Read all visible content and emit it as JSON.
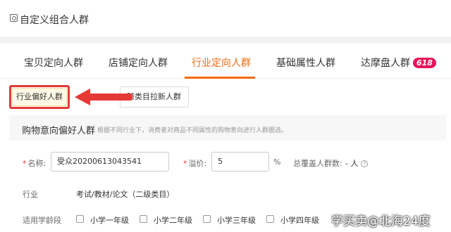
{
  "header": {
    "title": "自定义组合人群",
    "icon": "audience-icon"
  },
  "tabs": [
    {
      "label": "宝贝定向人群",
      "active": false
    },
    {
      "label": "店铺定向人群",
      "active": false
    },
    {
      "label": "行业定向人群",
      "active": true
    },
    {
      "label": "基础属性人群",
      "active": false
    },
    {
      "label": "达摩盘人群",
      "active": false,
      "badge": "618"
    }
  ],
  "subtabs": [
    {
      "label": "行业偏好人群",
      "active": true
    },
    {
      "label": "跨类目拉新人群",
      "active": false
    }
  ],
  "section": {
    "title": "购物意向偏好人群",
    "description": "根据不同行业下，消费者对商品不同属性的购物意向进行人群圈选。"
  },
  "form": {
    "name_label": "名称:",
    "name_value": "受众20200613043541",
    "premium_label": "溢价:",
    "premium_value": "5",
    "premium_unit": "%",
    "coverage_label": "总覆盖人群数:",
    "coverage_value": "- 人",
    "industry_label": "行业",
    "industry_value": "考试/教材/论文（二级类目）",
    "stage_label": "适用学龄段",
    "stage_options": [
      "小学一年级",
      "小学二年级",
      "小学三年级",
      "小学四年级"
    ]
  },
  "watermark": "学买卖@北海24度",
  "colors": {
    "accent": "#f36b12",
    "highlight": "#e53935",
    "badge": "#e5155e"
  }
}
